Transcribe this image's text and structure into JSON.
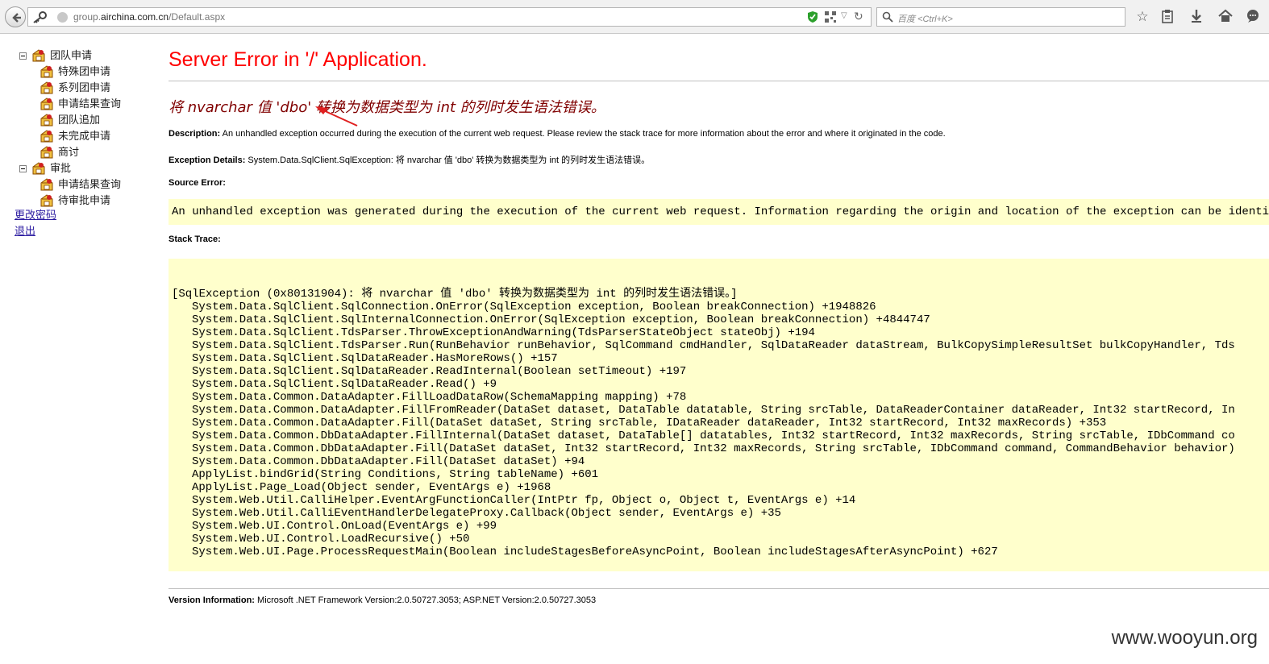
{
  "browser": {
    "url_prefix": "group.",
    "url_domain": "airchina.com.cn",
    "url_path": "/Default.aspx",
    "search_placeholder": "百度 <Ctrl+K>"
  },
  "nav": {
    "groups": [
      {
        "label": "团队申请",
        "items": [
          "特殊团申请",
          "系列团申请",
          "申请结果查询",
          "团队追加",
          "未完成申请",
          "商讨"
        ]
      },
      {
        "label": "审批",
        "items": [
          "申请结果查询",
          "待审批申请"
        ]
      }
    ],
    "links": [
      "更改密码",
      "退出"
    ]
  },
  "error": {
    "title": "Server Error in '/' Application.",
    "message": "将 nvarchar 值 'dbo' 转换为数据类型为 int 的列时发生语法错误。",
    "description_label": "Description:",
    "description_text": "An unhandled exception occurred during the execution of the current web request. Please review the stack trace for more information about the error and where it originated in the code.",
    "exception_label": "Exception Details:",
    "exception_text": "System.Data.SqlClient.SqlException: 将 nvarchar 值 'dbo' 转换为数据类型为 int 的列时发生语法错误。",
    "source_label": "Source Error:",
    "source_text": "An unhandled exception was generated during the execution of the current web request. Information regarding the origin and location of the exception can be identified usi",
    "stack_label": "Stack Trace:",
    "stack_header": "[SqlException (0x80131904): 将 nvarchar 值 'dbo' 转换为数据类型为 int 的列时发生语法错误。]",
    "stack_lines": [
      "System.Data.SqlClient.SqlConnection.OnError(SqlException exception, Boolean breakConnection) +1948826",
      "System.Data.SqlClient.SqlInternalConnection.OnError(SqlException exception, Boolean breakConnection) +4844747",
      "System.Data.SqlClient.TdsParser.ThrowExceptionAndWarning(TdsParserStateObject stateObj) +194",
      "System.Data.SqlClient.TdsParser.Run(RunBehavior runBehavior, SqlCommand cmdHandler, SqlDataReader dataStream, BulkCopySimpleResultSet bulkCopyHandler, Tds",
      "System.Data.SqlClient.SqlDataReader.HasMoreRows() +157",
      "System.Data.SqlClient.SqlDataReader.ReadInternal(Boolean setTimeout) +197",
      "System.Data.SqlClient.SqlDataReader.Read() +9",
      "System.Data.Common.DataAdapter.FillLoadDataRow(SchemaMapping mapping) +78",
      "System.Data.Common.DataAdapter.FillFromReader(DataSet dataset, DataTable datatable, String srcTable, DataReaderContainer dataReader, Int32 startRecord, In",
      "System.Data.Common.DataAdapter.Fill(DataSet dataSet, String srcTable, IDataReader dataReader, Int32 startRecord, Int32 maxRecords) +353",
      "System.Data.Common.DbDataAdapter.FillInternal(DataSet dataset, DataTable[] datatables, Int32 startRecord, Int32 maxRecords, String srcTable, IDbCommand co",
      "System.Data.Common.DbDataAdapter.Fill(DataSet dataSet, Int32 startRecord, Int32 maxRecords, String srcTable, IDbCommand command, CommandBehavior behavior)",
      "System.Data.Common.DbDataAdapter.Fill(DataSet dataSet) +94",
      "ApplyList.bindGrid(String Conditions, String tableName) +601",
      "ApplyList.Page_Load(Object sender, EventArgs e) +1968",
      "System.Web.Util.CalliHelper.EventArgFunctionCaller(IntPtr fp, Object o, Object t, EventArgs e) +14",
      "System.Web.Util.CalliEventHandlerDelegateProxy.Callback(Object sender, EventArgs e) +35",
      "System.Web.UI.Control.OnLoad(EventArgs e) +99",
      "System.Web.UI.Control.LoadRecursive() +50",
      "System.Web.UI.Page.ProcessRequestMain(Boolean includeStagesBeforeAsyncPoint, Boolean includeStagesAfterAsyncPoint) +627"
    ],
    "version_label": "Version Information:",
    "version_text": "Microsoft .NET Framework Version:2.0.50727.3053; ASP.NET Version:2.0.50727.3053"
  },
  "watermark": "www.wooyun.org",
  "colors": {
    "title_red": "#ff0000",
    "message_maroon": "#800000",
    "code_bg": "#ffffcc",
    "link_blue": "#2a1aa0",
    "arrow_red": "#e02020"
  }
}
